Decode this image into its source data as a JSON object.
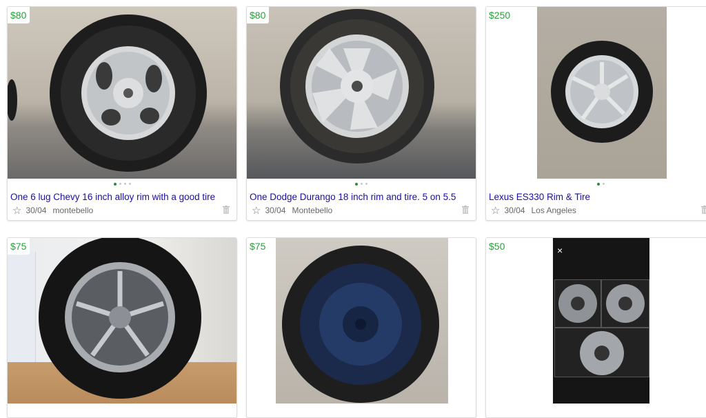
{
  "listings": [
    {
      "price": "$80",
      "title": "One 6 lug Chevy 16 inch alloy rim with a good tire",
      "date": "30/04",
      "location": "montebello",
      "image_count": 4,
      "active_image": 1,
      "star_icon": "star-outline-icon",
      "trash_icon": "trash-icon"
    },
    {
      "price": "$80",
      "title": "One Dodge Durango 18 inch rim and tire. 5 on 5.5",
      "date": "30/04",
      "location": "Montebello",
      "image_count": 3,
      "active_image": 1,
      "star_icon": "star-outline-icon",
      "trash_icon": "trash-icon"
    },
    {
      "price": "$250",
      "title": "Lexus ES330 Rim & Tire",
      "date": "30/04",
      "location": "Los Angeles",
      "image_count": 2,
      "active_image": 1,
      "star_icon": "star-outline-icon",
      "trash_icon": "trash-icon"
    },
    {
      "price": "$75"
    },
    {
      "price": "$75"
    },
    {
      "price": "$50",
      "close_glyph": "×"
    }
  ],
  "colors": {
    "price": "#26a23a",
    "title_link": "#1a0dab",
    "meta": "#666666",
    "dot_active": "#2d8a38"
  }
}
